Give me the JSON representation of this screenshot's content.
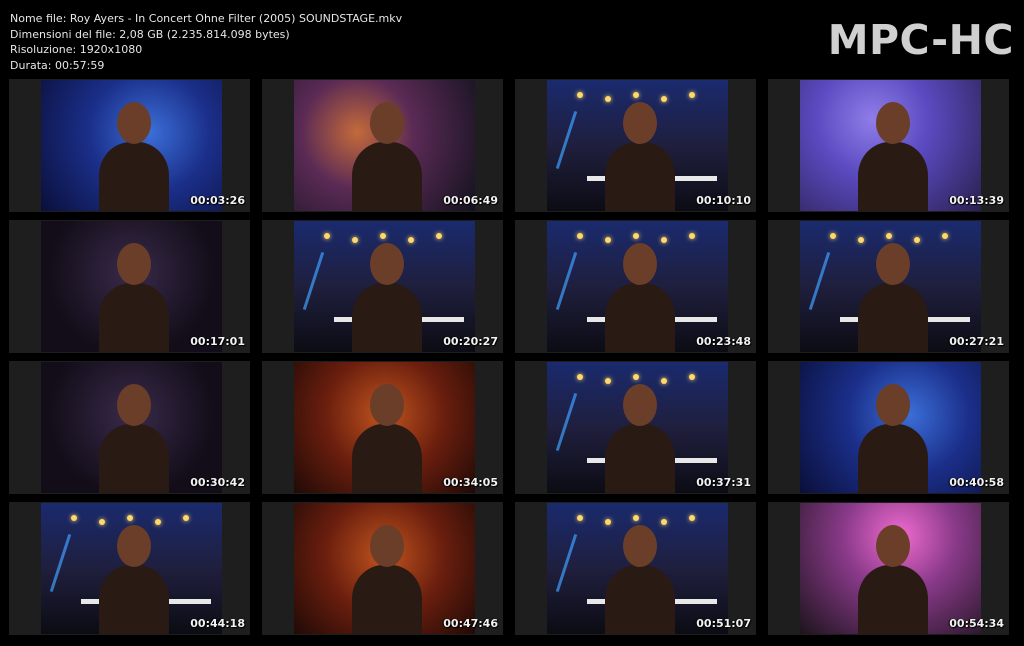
{
  "file_info": {
    "name_line": "Nome file: Roy Ayers - In Concert Ohne Filter (2005) SOUNDSTAGE.mkv",
    "size_line": "Dimensioni del file: 2,08 GB (2.235.814.098 bytes)",
    "resolution_line": "Risoluzione: 1920x1080",
    "duration_line": "Durata: 00:57:59"
  },
  "logo_text": "MPC-HC",
  "thumbnails": [
    {
      "timestamp": "00:03:26",
      "scene": "blue"
    },
    {
      "timestamp": "00:06:49",
      "scene": "drum"
    },
    {
      "timestamp": "00:10:10",
      "scene": "stage"
    },
    {
      "timestamp": "00:13:39",
      "scene": "violet"
    },
    {
      "timestamp": "00:17:01",
      "scene": "dark"
    },
    {
      "timestamp": "00:20:27",
      "scene": "stage"
    },
    {
      "timestamp": "00:23:48",
      "scene": "stage"
    },
    {
      "timestamp": "00:27:21",
      "scene": "stage"
    },
    {
      "timestamp": "00:30:42",
      "scene": "dark"
    },
    {
      "timestamp": "00:34:05",
      "scene": "warm"
    },
    {
      "timestamp": "00:37:31",
      "scene": "stage"
    },
    {
      "timestamp": "00:40:58",
      "scene": "blue"
    },
    {
      "timestamp": "00:44:18",
      "scene": "stage"
    },
    {
      "timestamp": "00:47:46",
      "scene": "warm"
    },
    {
      "timestamp": "00:51:07",
      "scene": "stage"
    },
    {
      "timestamp": "00:54:34",
      "scene": "pink"
    }
  ]
}
